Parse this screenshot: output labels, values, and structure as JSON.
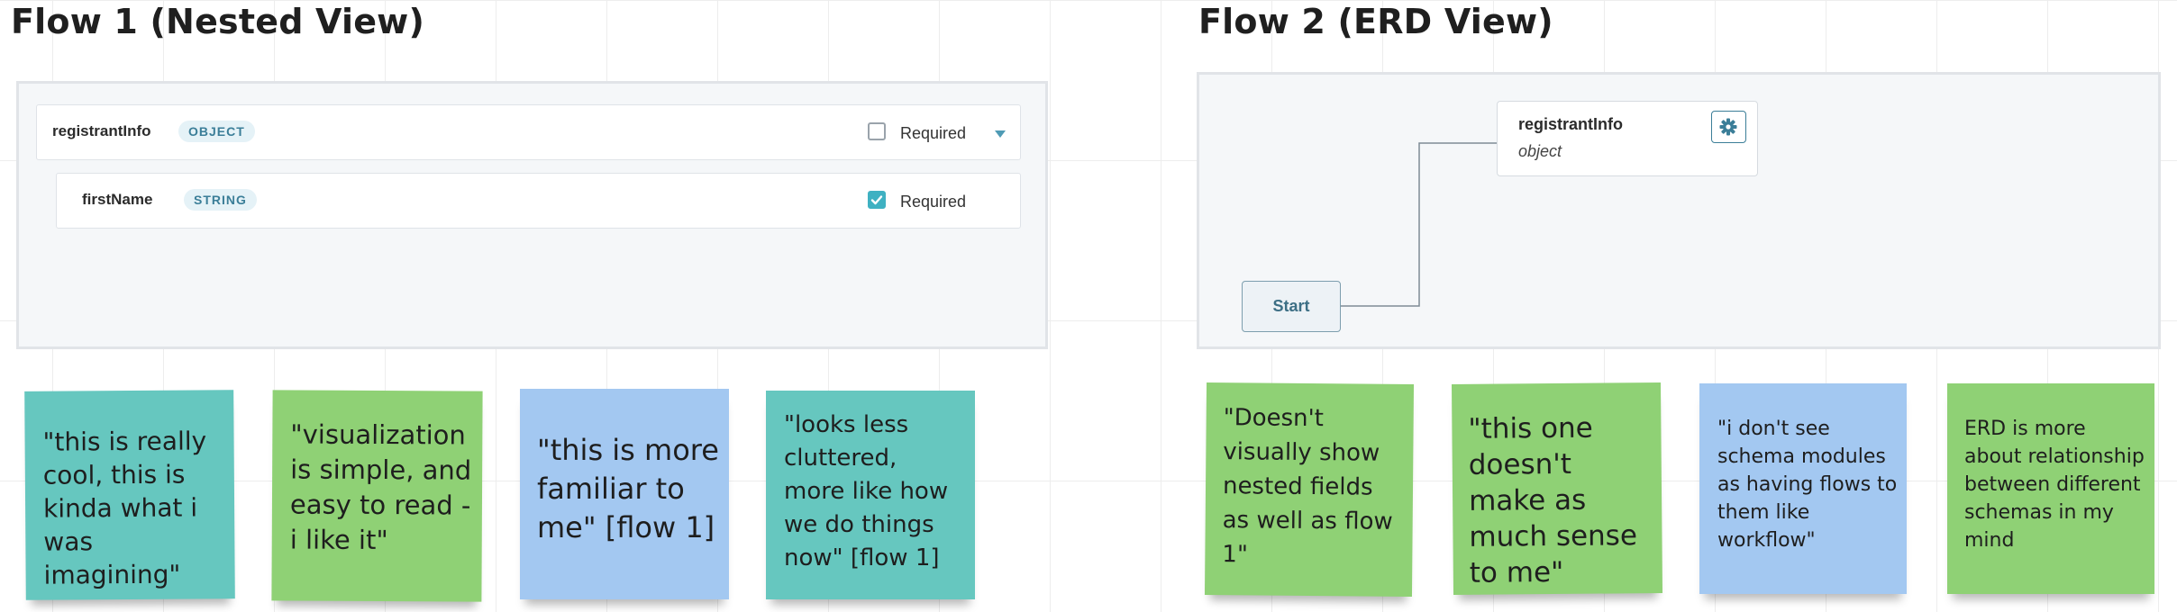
{
  "flow1": {
    "title": "Flow 1 (Nested View)",
    "rows": [
      {
        "name": "registrantInfo",
        "type": "OBJECT",
        "required_label": "Required",
        "required": false,
        "expand_icon": "chevron-down-icon"
      },
      {
        "name": "firstName",
        "type": "STRING",
        "required_label": "Required",
        "required": true
      }
    ],
    "notes": [
      {
        "text": "\"this is really cool, this is kinda what i was imagining\"",
        "color": "#66c7bf"
      },
      {
        "text": "\"visualization is simple, and easy to read - i like it\"",
        "color": "#8fd175"
      },
      {
        "text": "\"this is more familiar to me\" [flow 1]",
        "color": "#a3c8f1"
      },
      {
        "text": "\"looks less cluttered, more like how we do things now\" [flow 1]",
        "color": "#66c7bf"
      }
    ]
  },
  "flow2": {
    "title": "Flow 2 (ERD View)",
    "node": {
      "name": "registrantInfo",
      "type": "object",
      "settings_icon": "gear-icon"
    },
    "start_label": "Start",
    "notes": [
      {
        "text": "\"Doesn't visually show nested fields as well as flow 1\"",
        "color": "#8fd175"
      },
      {
        "text": "\"this one doesn't make as much sense to me\"",
        "color": "#8fd175"
      },
      {
        "text": "\"i don't see schema modules as having flows to them like workflow\"",
        "color": "#a3c8f1"
      },
      {
        "text": "ERD is more about relationship between different schemas in my mind",
        "color": "#8fd175"
      }
    ]
  },
  "colors": {
    "accent": "#3fb1c2",
    "badge_text": "#3b7e98",
    "sticky_teal": "#66c7bf",
    "sticky_green": "#8fd175",
    "sticky_blue": "#a3c8f1"
  }
}
